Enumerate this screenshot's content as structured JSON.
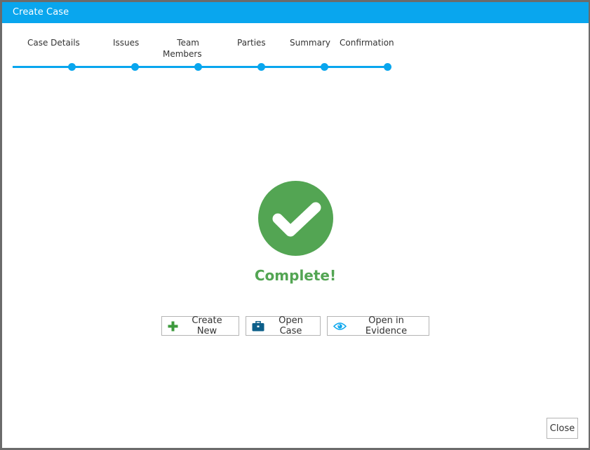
{
  "window": {
    "title": "Create Case"
  },
  "wizard": {
    "steps": [
      {
        "label": "Case Details"
      },
      {
        "label": "Issues"
      },
      {
        "label_line1": "Team",
        "label_line2": "Members"
      },
      {
        "label": "Parties"
      },
      {
        "label": "Summary"
      },
      {
        "label": "Confirmation"
      }
    ]
  },
  "result": {
    "status_text": "Complete!"
  },
  "actions": {
    "create_new": {
      "label": "Create New",
      "icon": "plus-icon"
    },
    "open_case": {
      "label": "Open Case",
      "icon": "briefcase-icon"
    },
    "open_in_evidence": {
      "label": "Open in Evidence",
      "icon": "eye-icon"
    }
  },
  "footer": {
    "close_label": "Close"
  },
  "colors": {
    "accent": "#09a6ee",
    "success": "#53a553",
    "create_icon": "#3d9a3d",
    "briefcase_icon": "#0d5f8a"
  }
}
